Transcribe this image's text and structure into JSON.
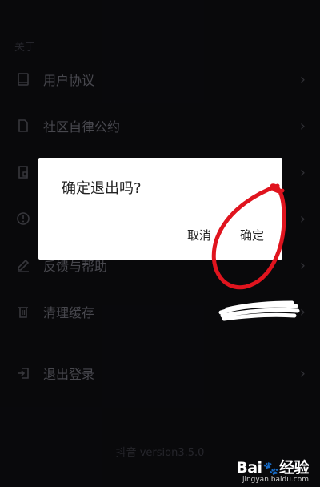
{
  "section": {
    "label": "关于"
  },
  "rows": [
    {
      "label": "用户协议",
      "icon": "book-icon"
    },
    {
      "label": "社区自律公约",
      "icon": "document-icon"
    },
    {
      "label": "",
      "icon": "lock-document-icon"
    },
    {
      "label": "",
      "icon": "info-circle-icon"
    },
    {
      "label": "反馈与帮助",
      "icon": "edit-icon"
    },
    {
      "label": "清理缓存",
      "icon": "trash-icon"
    },
    {
      "label": "退出登录",
      "icon": "logout-icon"
    }
  ],
  "dialog": {
    "title": "确定退出吗?",
    "cancel": "取消",
    "confirm": "确定"
  },
  "footer": {
    "version": "抖音 version3.5.0"
  },
  "watermark": {
    "brand_left": "Bai",
    "brand_right": "经验",
    "sub": "jingyan.baidu.com"
  },
  "colors": {
    "background": "#0e0e12",
    "dialog": "#ffffff",
    "annotation": "#e0141e"
  }
}
